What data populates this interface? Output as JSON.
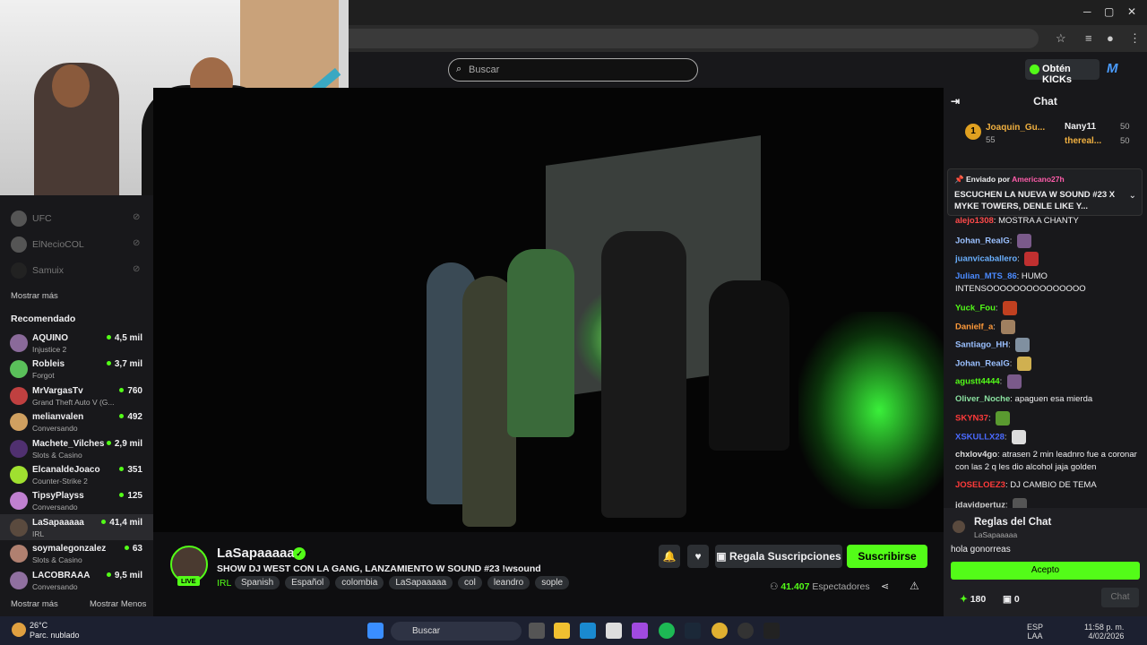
{
  "header": {
    "search_placeholder": "Buscar",
    "kicks_label": "Obtén KICKs",
    "logo": "M"
  },
  "sidebar": {
    "offline": [
      {
        "name": "UFC"
      },
      {
        "name": "ElNecioCOL"
      },
      {
        "name": "Samuix"
      }
    ],
    "show_more": "Mostrar más",
    "recommended_title": "Recomendado",
    "recommended": [
      {
        "name": "AQUINO",
        "category": "Injustice 2",
        "viewers": "4,5 mil",
        "color": "#8a6a9a"
      },
      {
        "name": "Robleis",
        "category": "Forgot",
        "viewers": "3,7 mil",
        "color": "#5ac05a"
      },
      {
        "name": "MrVargasTv",
        "category": "Grand Theft Auto V (G...",
        "viewers": "760",
        "color": "#c04040"
      },
      {
        "name": "melianvalen",
        "category": "Conversando",
        "viewers": "492",
        "color": "#d0a060"
      },
      {
        "name": "Machete_Vilches",
        "category": "Slots & Casino",
        "viewers": "2,9 mil",
        "color": "#503070"
      },
      {
        "name": "ElcanaldeJoaco",
        "category": "Counter-Strike 2",
        "viewers": "351",
        "color": "#a0e030"
      },
      {
        "name": "TipsyPlayss",
        "category": "Conversando",
        "viewers": "125",
        "color": "#c080d0"
      },
      {
        "name": "LaSapaaaaa",
        "category": "IRL",
        "viewers": "41,4 mil",
        "color": "#5a4a3e"
      },
      {
        "name": "soymalegonzalez",
        "category": "Slots & Casino",
        "viewers": "63",
        "color": "#b08070"
      },
      {
        "name": "LACOBRAAA",
        "category": "Conversando",
        "viewers": "9,5 mil",
        "color": "#9070a0"
      }
    ],
    "footer_more": "Mostrar más",
    "footer_less": "Mostrar Menos"
  },
  "stream": {
    "channel": "LaSapaaaaa",
    "live": "LIVE",
    "title": "SHOW DJ WEST CON LA GANG, LANZAMIENTO W SOUND #23 !wsound",
    "category": "IRL",
    "tags": [
      "Spanish",
      "Español",
      "colombia",
      "LaSapaaaaa",
      "col",
      "leandro",
      "sople"
    ],
    "gift_label": "Regala Suscripciones",
    "subscribe_label": "Suscribirse",
    "viewers": "41.407",
    "viewers_label": "Espectadores"
  },
  "chat": {
    "title": "Chat",
    "leaders": [
      {
        "rank": "1",
        "name": "Joaquin_Gu...",
        "pts": "55"
      },
      {
        "name": "Nany11",
        "pts": "50"
      },
      {
        "name": "thereal...",
        "pts": "50"
      }
    ],
    "pinned": {
      "by": "Enviado por",
      "user": "Americano27h",
      "text": "ESCUCHEN LA NUEVA W SOUND #23 X MYKE TOWERS, DENLE LIKE Y..."
    },
    "messages": [
      {
        "user": "alejo1308",
        "text": "MOSTRA A CHANTY",
        "color": "#ff4a4a"
      },
      {
        "user": "Johan_RealG",
        "text": "",
        "color": "#9ac0ff"
      },
      {
        "user": "juanvicaballero",
        "text": "",
        "color": "#6ab0ff"
      },
      {
        "user": "Julian_MTS_86",
        "text": "HUMO INTENSOOOOOOOOOOOOOOO",
        "color": "#4a8aff"
      },
      {
        "user": "Yuck_Fou",
        "text": "",
        "color": "#53fc18"
      },
      {
        "user": "Danielf_a",
        "text": "",
        "color": "#ff9a3a"
      },
      {
        "user": "Santiago_HH",
        "text": "",
        "color": "#9ac0ff"
      },
      {
        "user": "Johan_RealG",
        "text": "",
        "color": "#9ac0ff"
      },
      {
        "user": "agustt4444",
        "text": "",
        "color": "#53fc18"
      },
      {
        "user": "Oliver_Noche",
        "text": "apaguen esa mierda",
        "color": "#8ae0a0"
      },
      {
        "user": "SKYN37",
        "text": "",
        "color": "#ff3a3a"
      },
      {
        "user": "XSKULLX28",
        "text": "",
        "color": "#4a6aff"
      },
      {
        "user": "chxlov4go",
        "text": "atrasen 2 min leadnro fue a coronar con las 2 q les dio alcohol jaja golden",
        "color": "#dddddd"
      },
      {
        "user": "JOSELOEZ3",
        "text": "DJ CAMBIO DE TEMA",
        "color": "#ff3a3a"
      },
      {
        "user": "jdavidpertuz",
        "text": "",
        "color": "#cfcfcf"
      }
    ],
    "rules": {
      "title": "Reglas del Chat",
      "sub": "LaSapaaaaa",
      "rule": "hola gonorreas",
      "accept": "Acepto"
    },
    "points": "180",
    "gifts": "0",
    "send_label": "Chat"
  },
  "taskbar": {
    "temp": "26°C",
    "weather": "Parc. nublado",
    "search": "Buscar",
    "lang1": "ESP",
    "lang2": "LAA",
    "time": "11:58 p. m.",
    "date": "4/02/2026"
  }
}
